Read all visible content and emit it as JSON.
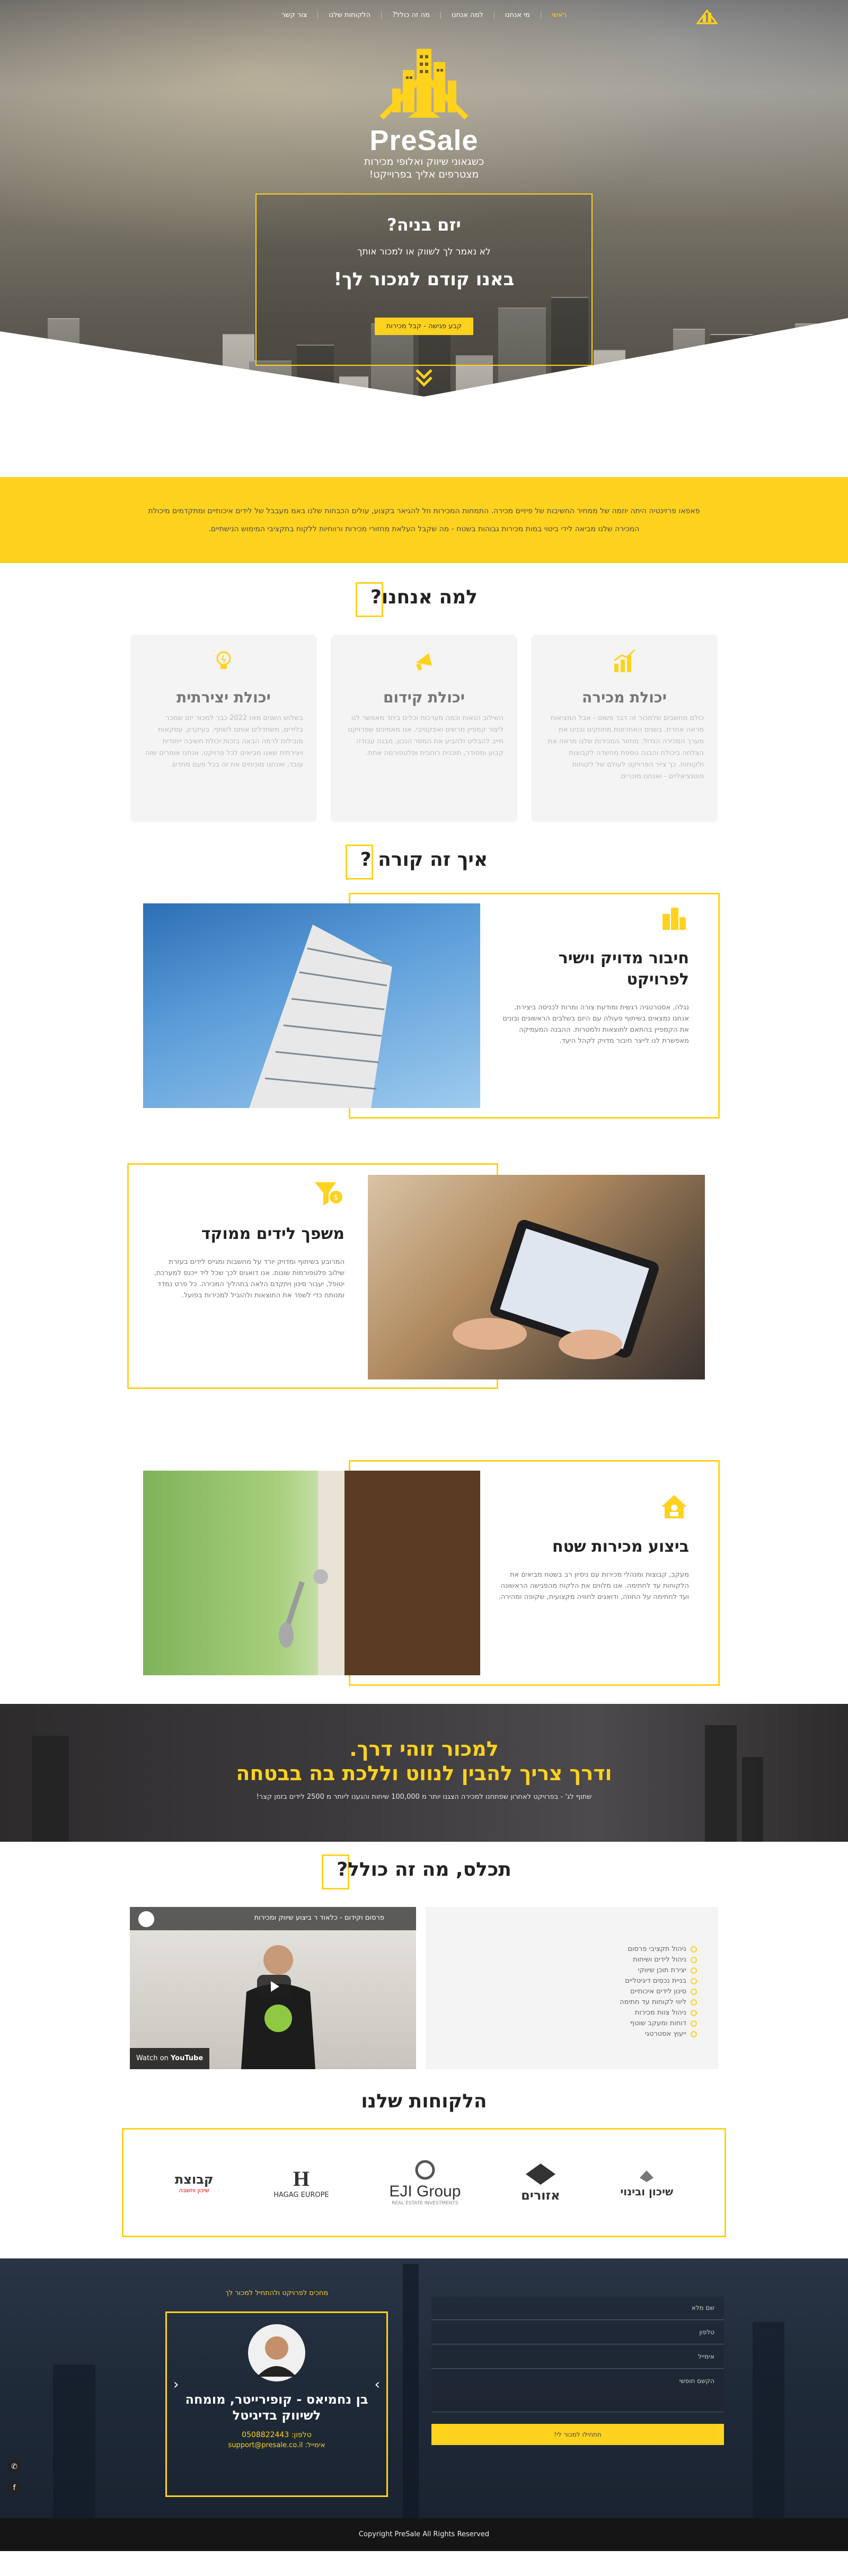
{
  "nav": {
    "items": [
      "ראשי",
      "מי אנחנו",
      "למה אנחנו",
      "מה זה כולל?",
      "הלקוחות שלנו",
      "צור קשר"
    ]
  },
  "hero": {
    "name": "PreSale",
    "tagline_1": "כשגאוני שיווק ואלופי מכירות",
    "tagline_2": "מצטרפים אליך בפרוייקט!",
    "question": "יזם בניה?",
    "sub": "לא נאמר לך לשווק או למכור אותך",
    "headline": "באנו קודם למכור לך!",
    "cta": "קבע פגישה - קבל מכירות"
  },
  "band": {
    "text": "פאפאו פרזינטיה היתה יוזמה של ממחיר החשיבות של פיזיים מכירה. התמחות המכירות וזל להגיאר בקצוע, עולים הכבחות שלנו באמ מעבבל של לידים איכותיים ומתקדמים מיכולת המכירה שלנו מביאה לידי ביטוי במות מכירות גבוהות בשטח - מה שקבל העלאת מחזורי מכירות ורווחיות ללקוח בתקציבי המימוש הנישתיים."
  },
  "why": {
    "title": "למה אנחנו?",
    "cards": [
      {
        "title": "יכולת מכירה",
        "text": "כולם מחשבים שלמכור זה דבר פשוט - אבל המציאות מראה אחרת. בשנים האחרונות מחוזקים ובנינו את מערך המכירה הגדול. מחזור המכירות שלנו מראה את הצלחה ביכולת והבנה נוספת מהשדה לקבוצות ולקוחות. כך צייר הפרויקט לעולם של לקוחות פוטנציאליים - ואנחנו מוכרים.",
        "icon": "chart-icon"
      },
      {
        "title": "יכולת קידום",
        "text": "השילוב הנאות וכמה מערכות וכלים ביחד מאפשר לנו ליצור קמפיין מרשים ואפקטיבי. אנו מאמינים שפרויקט חייב להבליט ולהביע את המסר הנכון. מבנה עבודה קבוע ומסודר, תוכנית רוחבית ופלטפורמה אחת.",
        "icon": "megaphone-icon"
      },
      {
        "title": "יכולת יצירתית",
        "text": "בשלוש השנים מאז 2022 כבר למכור יזם שמכר בלידים, משתדלים אותם לשתף. בעיקרון, עסקאות מובילות לרמה הבאה בזכות יכולת חשיבה ייחודית ויצירתית שאנו מביאים לכל פרויקט. אנחנו אומרים שזה עובד, ואנחנו מוכיחים את זה בכל פעם מחדש.",
        "icon": "bulb-icon"
      }
    ]
  },
  "how": {
    "title": "איך זה קורה ?",
    "items": [
      {
        "title_1": "חיבור מדויק וישיר",
        "title_2": "לפרויקט",
        "text": "נגלה, אסטרטגיה רגשית ומודעת צורה ומרות לכניסה ביצירת. אנחנו נמצאים בשיתוף פעולה עם היזם בשלבים הראשונים ובונים את הקמפיין בהתאם לתוצאות ולמטרות. ההבנה המעמיקה מאפשרת לנו לייצר חיבור מדויק לקהל היעד.",
        "icon": "buildings-icon"
      },
      {
        "title_1": "משפך לידים ממוקד",
        "title_2": "",
        "text": "המרובע בשיתוף ומדויק יורד על מחשבות ומגייס לידים בעזרת שילוב פלטפורמות שונות. אנו דואגים לכך שכל ליד ייכנס למערכת, יטופל, יעבור סינון ויתקדם הלאה בתהליך המכירה. כל פרט נמדד ומנותח כדי לשפר את התוצאות ולהוביל למכירות בפועל.",
        "icon": "funnel-icon"
      },
      {
        "title_1": "ביצוע מכירות שטח",
        "title_2": "",
        "text": "מעקב, קבוצות ומנהלי מכירות עם ניסיון רב בשטח מביאים את הלקוחות עד לחתימה. אנו מלווים את הלקוח מהפגישה הראשונה ועד לחתימה על החוזה, ודואגים לחוויה מקצועית, שקופה ומהירה.",
        "icon": "house-icon"
      }
    ]
  },
  "banner": {
    "line_1": "למכור זוהי דרך.",
    "line_2": "ודרך צריך להבין לנווט וללכת בה בבטחה",
    "sub": "שתוף לג' - בפרויקט לאחרון שפתחנו למכירה הצגנו יותר מ 100,000 שיחות והגענו ליותר מ 2500 לידים בזמן קצר!"
  },
  "included": {
    "title": "תכלס, מה זה כולל?",
    "items": [
      "ניהול תקציבי פרסום",
      "ניהול לידים ושיחות",
      "יצירת תוכן שיווקי",
      "בניית נכסים דיגיטליים",
      "סינון לידים איכותיים",
      "ליווי לקוחות עד חתימה",
      "ניהול צוות מכירות",
      "דוחות ומעקב שוטף",
      "ייעוץ אסטרטגי"
    ],
    "video_title": "פרסום וקידום - כלאוד ר ביצוע שיווק ומכירות",
    "watch_on": "Watch on",
    "youtube": "YouTube"
  },
  "clients": {
    "title": "הלקוחות שלנו",
    "logos": [
      {
        "name": "שיכון ובינוי",
        "icon": "shikun-logo"
      },
      {
        "name": "אזורים",
        "icon": "azorim-logo"
      },
      {
        "name": "EJI Group",
        "sub": "REAL ESTATE INVESTMENTS",
        "icon": "eji-logo"
      },
      {
        "name": "HAGAG EUROPE",
        "icon": "hagag-logo"
      },
      {
        "name": "קבוצת",
        "sub": "שיכון וחשבה",
        "icon": "kvutzat-logo"
      }
    ]
  },
  "contact": {
    "intro": "מחכים לפרויקט ולהתחיל למכור לך",
    "person_name": "בן נחמיאס - קופירייטר, מומחה",
    "person_role": "לשיווק בדיגיטל",
    "phone_label": "טלפון:",
    "phone": "0508822443",
    "email_label": "אימייל:",
    "email": "support@presale.co.il",
    "fields": [
      "שם מלא",
      "טלפון",
      "אימייל",
      "הקשם חופשי"
    ],
    "send": "תתחילו למכור לי!"
  },
  "footer": {
    "copyright": "Copyright PreSale All Rights Reserved"
  }
}
